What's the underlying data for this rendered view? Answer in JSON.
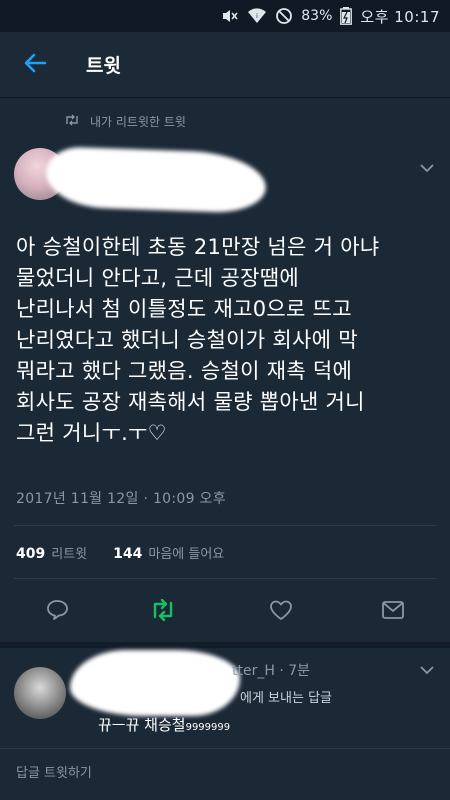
{
  "status_bar": {
    "battery": "83%",
    "time": "오후 10:17"
  },
  "header": {
    "title": "트윗"
  },
  "tweet": {
    "retweet_note": "내가 리트윗한 트윗",
    "text": "아 승철이한테 초동 21만장 넘은 거 아냐\n물었더니 안다고, 근데 공장땜에\n난리나서 첨 이틀정도 재고0으로 뜨고\n난리였다고 했더니 승철이가 회사에 막\n뭐라고 했다 그랬음. 승철이 재촉 덕에\n회사도 공장 재촉해서 물량 뽑아낸 거니\n그런 거니ㅜ.ㅜ♡",
    "timestamp": "2017년 11월 12일 · 10:09 오후",
    "retweet_count": "409",
    "retweet_label": "리트윗",
    "like_count": "144",
    "like_label": "마음에 들어요",
    "colors": {
      "accent_blue": "#1da1f2",
      "retweet_green": "#17bf63",
      "secondary_text": "#8899a6"
    }
  },
  "reply": {
    "handle_suffix": "tter_H · 7분",
    "reply_to": "에게 보내는 답글",
    "text_main": "뀨ㅡ뀨 채승철",
    "text_tail": "9999999"
  },
  "compose": {
    "placeholder": "답글 트윗하기"
  },
  "icons": [
    "mute-icon",
    "wifi-icon",
    "do-not-disturb-icon",
    "battery-charging-icon",
    "back-arrow-icon",
    "retweet-icon",
    "chevron-down-icon",
    "reply-icon",
    "heart-icon",
    "direct-message-icon"
  ]
}
